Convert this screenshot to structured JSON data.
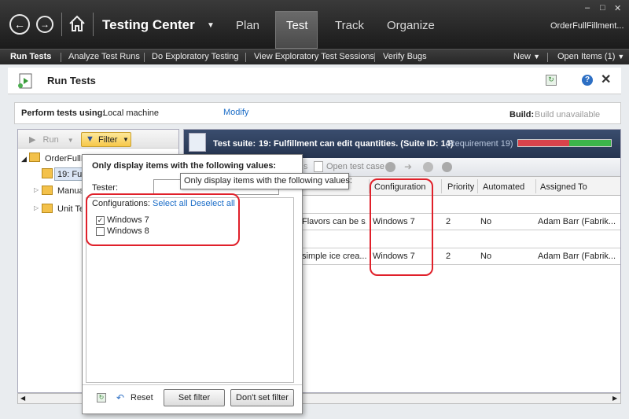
{
  "topbar": {
    "title": "Testing Center",
    "tabs": [
      "Plan",
      "Test",
      "Track",
      "Organize"
    ],
    "project": "OrderFullFillment...",
    "window_controls": [
      "–",
      "□",
      "✕"
    ]
  },
  "subnav": {
    "items": [
      "Run Tests",
      "Analyze Test Runs",
      "Do Exploratory Testing",
      "View Exploratory Test Sessions",
      "Verify Bugs"
    ],
    "new_label": "New",
    "open_items_label": "Open Items (1)"
  },
  "page": {
    "title": "Run Tests",
    "perform_label": "Perform tests using:",
    "perform_value": "Local machine",
    "modify": "Modify",
    "build_label": "Build:",
    "build_value": "Build unavailable"
  },
  "left": {
    "run_label": "Run",
    "filter_label": "Filter",
    "tree": [
      "OrderFullF",
      "19: Fulf",
      "Manua",
      "Unit Te"
    ]
  },
  "suite": {
    "label": "Test suite:",
    "name": "19: Fulfillment can edit quantities. (Suite ID: 14)",
    "requirement": "(Requirement 19)",
    "progress_red": 0.55,
    "progress_green": 0.45
  },
  "toolbar": {
    "open_test_case": "Open test case",
    "s_fragment": "s"
  },
  "grid": {
    "columns": [
      "Configuration",
      "Priority",
      "Automated",
      "Assigned To"
    ],
    "rows": [
      {
        "title": "Flavors can be s...",
        "configuration": "Windows 7",
        "priority": "2",
        "automated": "No",
        "assigned": "Adam Barr (Fabrik..."
      },
      {
        "title": "simple ice crea...",
        "configuration": "Windows 7",
        "priority": "2",
        "automated": "No",
        "assigned": "Adam Barr (Fabrik..."
      }
    ]
  },
  "popup": {
    "heading": "Only display items with the following values:",
    "tester_label": "Tester:",
    "configurations_label": "Configurations:",
    "select_all": "Select all",
    "deselect_all": "Deselect all",
    "options": [
      {
        "label": "Windows 7",
        "checked": true
      },
      {
        "label": "Windows 8",
        "checked": false
      }
    ],
    "reset": "Reset",
    "set_filter": "Set filter",
    "dont_set_filter": "Don't set filter"
  },
  "tooltip": "Only display items with the following values:",
  "colors": {
    "accent": "#1a6cc7",
    "highlight": "#e0202a",
    "suite_bar": "#2d3e5c"
  }
}
